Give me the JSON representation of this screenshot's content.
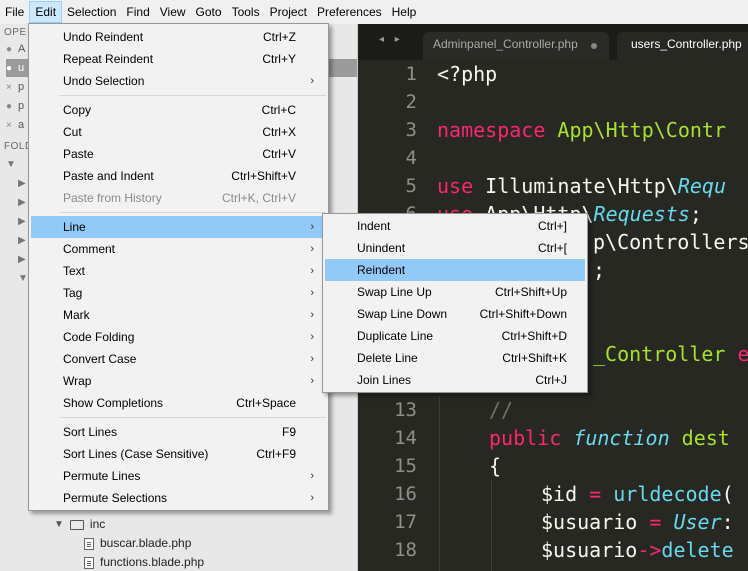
{
  "menubar": {
    "items": [
      "File",
      "Edit",
      "Selection",
      "Find",
      "View",
      "Goto",
      "Tools",
      "Project",
      "Preferences",
      "Help"
    ],
    "active": "Edit"
  },
  "sidebar": {
    "open_header": "OPE",
    "folders_header": "FOLD",
    "open_files": [
      {
        "icon": "●",
        "name": "A"
      },
      {
        "icon": "●",
        "name": "u"
      },
      {
        "icon": "×",
        "name": "p"
      },
      {
        "icon": "●",
        "name": "p"
      },
      {
        "icon": "×",
        "name": "a"
      }
    ],
    "tree_rows": [
      "▼",
      "▶",
      "▶",
      "▶",
      "▶",
      "▶",
      "▼"
    ],
    "bottom_folder": {
      "arrow": "▼",
      "name": "inc"
    },
    "bottom_files": [
      "buscar.blade.php",
      "functions.blade.php"
    ]
  },
  "editor": {
    "tab_nav": "◂ ▸",
    "tabs": [
      "Adminpanel_Controller.php",
      "users_Controller.php"
    ],
    "line_numbers": [
      "1",
      "2",
      "3",
      "4",
      "5",
      "6",
      "7",
      "8",
      "9",
      "10",
      "11",
      "12",
      "13",
      "14",
      "15",
      "16",
      "17",
      "18"
    ],
    "visible_fragments": {
      "l1": "<?php",
      "l3_kw": "namespace",
      "l3_ns": "App\\Http\\Contr",
      "l5_kw": "use",
      "l5_a": "Illuminate\\Http\\",
      "l5_b": "Requ",
      "l6_kw": "use",
      "l6_a": "App\\Http\\",
      "l6_b": "Requests",
      "l6_c": ";",
      "l7": "p\\Controllers",
      "l8": ";",
      "l11": "_Controller",
      "l11_b": "e",
      "l13": "//",
      "l14_kw": "public",
      "l14_fn": "function",
      "l14_name": "dest",
      "l15": "{",
      "l16_var": "$id",
      "l16_op": "=",
      "l16_fn": "urldecode",
      "l16_p": "(",
      "l17_var": "$usuario",
      "l17_op": "=",
      "l17_cls": "User",
      "l17_p": ":",
      "l18_var": "$usuario",
      "l18_op": "->",
      "l18_fn": "delete"
    }
  },
  "edit_menu": {
    "groups": [
      [
        {
          "label": "Undo Reindent",
          "shortcut": "Ctrl+Z"
        },
        {
          "label": "Repeat Reindent",
          "shortcut": "Ctrl+Y"
        },
        {
          "label": "Undo Selection",
          "submenu": true
        }
      ],
      [
        {
          "label": "Copy",
          "shortcut": "Ctrl+C"
        },
        {
          "label": "Cut",
          "shortcut": "Ctrl+X"
        },
        {
          "label": "Paste",
          "shortcut": "Ctrl+V"
        },
        {
          "label": "Paste and Indent",
          "shortcut": "Ctrl+Shift+V"
        },
        {
          "label": "Paste from History",
          "shortcut": "Ctrl+K, Ctrl+V",
          "disabled": true
        }
      ],
      [
        {
          "label": "Line",
          "submenu": true,
          "highlighted": true
        },
        {
          "label": "Comment",
          "submenu": true
        },
        {
          "label": "Text",
          "submenu": true
        },
        {
          "label": "Tag",
          "submenu": true
        },
        {
          "label": "Mark",
          "submenu": true
        },
        {
          "label": "Code Folding",
          "submenu": true
        },
        {
          "label": "Convert Case",
          "submenu": true
        },
        {
          "label": "Wrap",
          "submenu": true
        },
        {
          "label": "Show Completions",
          "shortcut": "Ctrl+Space"
        }
      ],
      [
        {
          "label": "Sort Lines",
          "shortcut": "F9"
        },
        {
          "label": "Sort Lines (Case Sensitive)",
          "shortcut": "Ctrl+F9"
        },
        {
          "label": "Permute Lines",
          "submenu": true
        },
        {
          "label": "Permute Selections",
          "submenu": true
        }
      ]
    ],
    "submenu_arrow": "›"
  },
  "line_menu": {
    "items": [
      {
        "label": "Indent",
        "shortcut": "Ctrl+]"
      },
      {
        "label": "Unindent",
        "shortcut": "Ctrl+["
      },
      {
        "label": "Reindent",
        "shortcut": "",
        "highlighted": true
      },
      {
        "label": "Swap Line Up",
        "shortcut": "Ctrl+Shift+Up"
      },
      {
        "label": "Swap Line Down",
        "shortcut": "Ctrl+Shift+Down"
      },
      {
        "label": "Duplicate Line",
        "shortcut": "Ctrl+Shift+D"
      },
      {
        "label": "Delete Line",
        "shortcut": "Ctrl+Shift+K"
      },
      {
        "label": "Join Lines",
        "shortcut": "Ctrl+J"
      }
    ]
  },
  "colors": {
    "menu_highlight": "#91c9f7",
    "editor_bg": "#272822",
    "keyword": "#f92672",
    "namespace": "#a6e22e",
    "function": "#66d9ef"
  }
}
